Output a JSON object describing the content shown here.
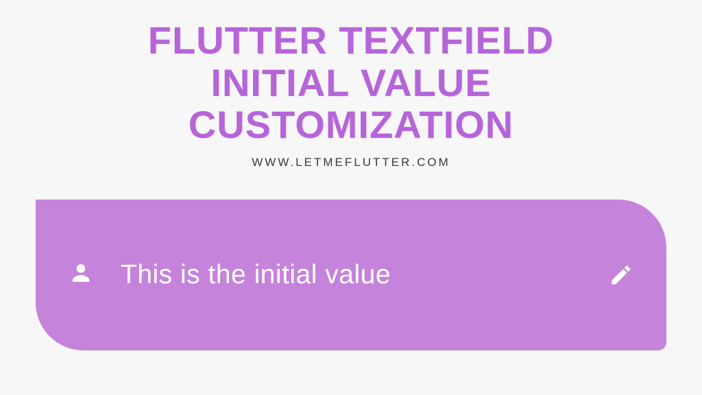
{
  "heading": {
    "line1": "Flutter Textfield",
    "line2": "Initial Value",
    "line3": "Customization"
  },
  "subheading": "WWW.LETMEFLUTTER.COM",
  "textfield": {
    "value": "This is the initial value"
  },
  "colors": {
    "accent": "#b565d8",
    "field_bg": "#c583db",
    "page_bg": "#f7f7f7",
    "field_text": "#ffffff"
  }
}
